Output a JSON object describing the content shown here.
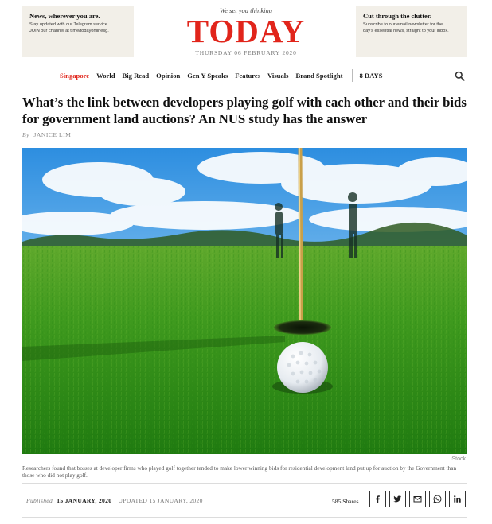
{
  "promos": {
    "left": {
      "title": "News, wherever you are.",
      "line1": "Stay updated with our Telegram service.",
      "line2": "JOIN our channel at t.me/todayonlinesg."
    },
    "right": {
      "title": "Cut through the clutter.",
      "line1": "Subscribe to our email newsletter for the",
      "line2": "day's essential news, straight to your inbox."
    }
  },
  "masthead": {
    "tagline": "We set you thinking",
    "logo": "TODAY",
    "date": "THURSDAY 06 FEBRUARY 2020"
  },
  "nav": {
    "items": [
      "Singapore",
      "World",
      "Big Read",
      "Opinion",
      "Gen Y Speaks",
      "Features",
      "Visuals",
      "Brand Spotlight"
    ],
    "extra": "8 DAYS",
    "active_index": 0
  },
  "article": {
    "headline": "What’s the link between developers playing golf with each other and their bids for government land auctions? An NUS study has the answer",
    "byline_prefix": "By",
    "author": "JANICE LIM",
    "image_credit": "iStock",
    "caption": "Researchers found that bosses at developer firms who played golf together tended to make lower winning bids for residential development land put up for auction by the Government than those who did not play golf.",
    "published_label": "Published",
    "published_date": "15 JANUARY, 2020",
    "updated_label": "UPDATED 15 JANUARY, 2020",
    "shares": "585 Shares"
  },
  "share_icons": [
    "facebook-icon",
    "twitter-icon",
    "email-icon",
    "whatsapp-icon",
    "linkedin-icon"
  ],
  "colors": {
    "brand": "#e1251b",
    "promo_bg": "#f2efe8"
  }
}
